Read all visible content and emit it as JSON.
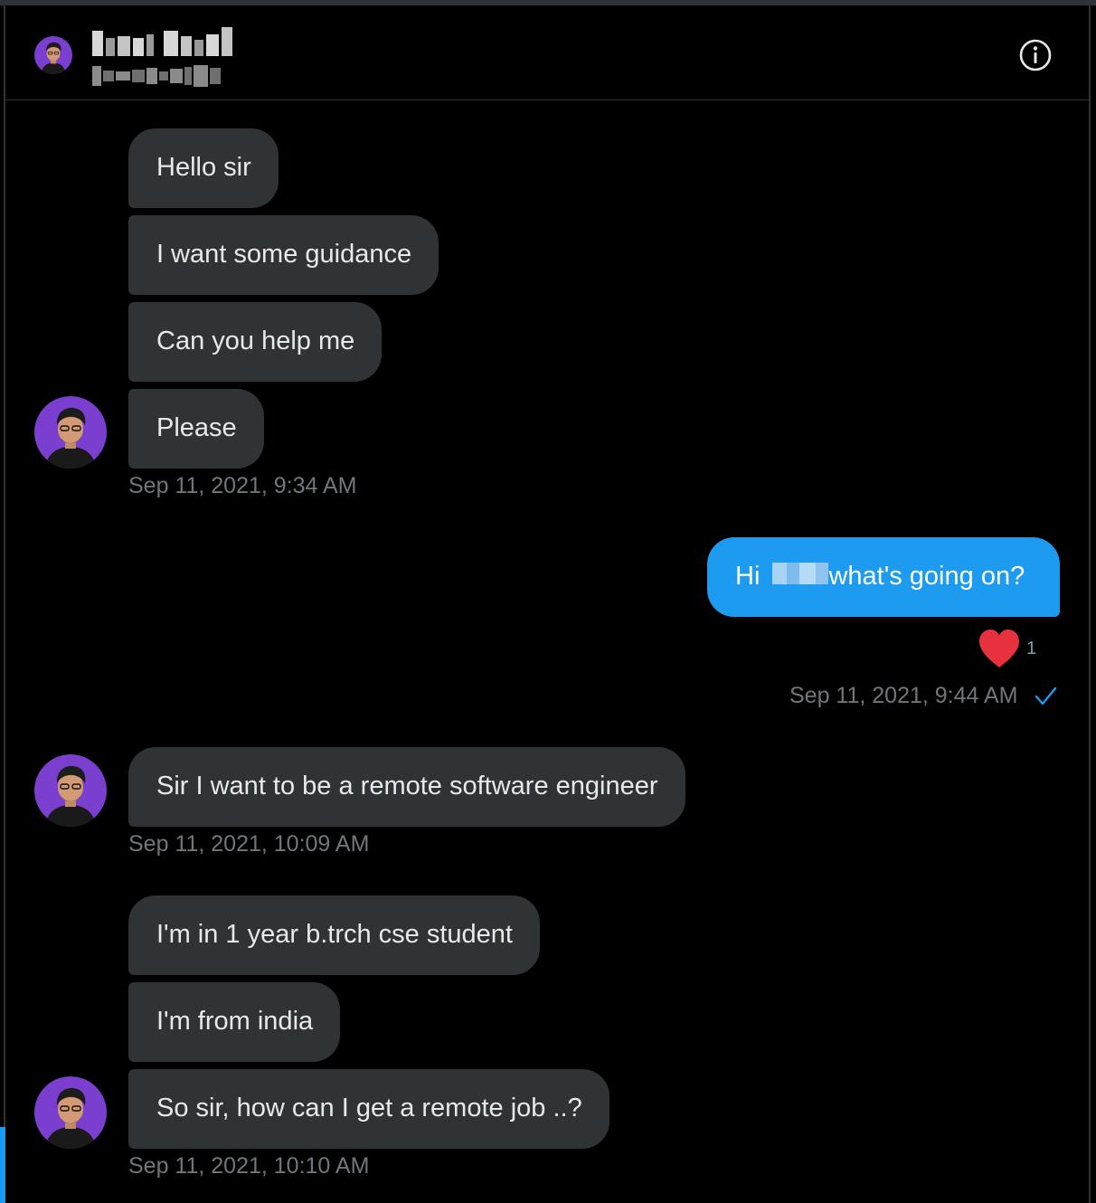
{
  "conversation": {
    "header": {
      "avatar_icon": "profile-avatar",
      "name_redacted": true,
      "handle_redacted": true,
      "info_icon": "info-icon"
    },
    "messages": [
      {
        "id": "m1",
        "direction": "received",
        "text": "Hello sir"
      },
      {
        "id": "m2",
        "direction": "received",
        "text": "I want some guidance"
      },
      {
        "id": "m3",
        "direction": "received",
        "text": "Can you help me"
      },
      {
        "id": "m4",
        "direction": "received",
        "text": "Please"
      },
      {
        "id": "t1",
        "type": "timestamp",
        "text": "Sep 11, 2021, 9:34 AM"
      },
      {
        "id": "m5",
        "direction": "sent",
        "text_prefix": "Hi",
        "text_suffix": "what's going on?",
        "has_redacted_name": true
      },
      {
        "id": "r1",
        "type": "reaction",
        "icon": "heart-icon",
        "count": "1"
      },
      {
        "id": "t2",
        "type": "timestamp",
        "text": "Sep 11, 2021, 9:44 AM",
        "status_icon": "checkmark-icon"
      },
      {
        "id": "m6",
        "direction": "received",
        "text": "Sir I want to be a remote software engineer"
      },
      {
        "id": "t3",
        "type": "timestamp",
        "text": "Sep 11, 2021, 10:09 AM"
      },
      {
        "id": "m7",
        "direction": "received",
        "text": "I'm in 1 year b.trch cse student"
      },
      {
        "id": "m8",
        "direction": "received",
        "text": "I'm from india"
      },
      {
        "id": "m9",
        "direction": "received",
        "text": "So sir, how can I get a remote job ..?"
      },
      {
        "id": "t4",
        "type": "timestamp",
        "text": "Sep 11, 2021, 10:10 AM"
      }
    ],
    "colors": {
      "background": "#000000",
      "received_bubble": "#2f3336",
      "sent_bubble": "#1d9bf0",
      "timestamp": "#71767b",
      "heart": "#e8313f",
      "avatar_bg": "#7b3fd0"
    }
  }
}
